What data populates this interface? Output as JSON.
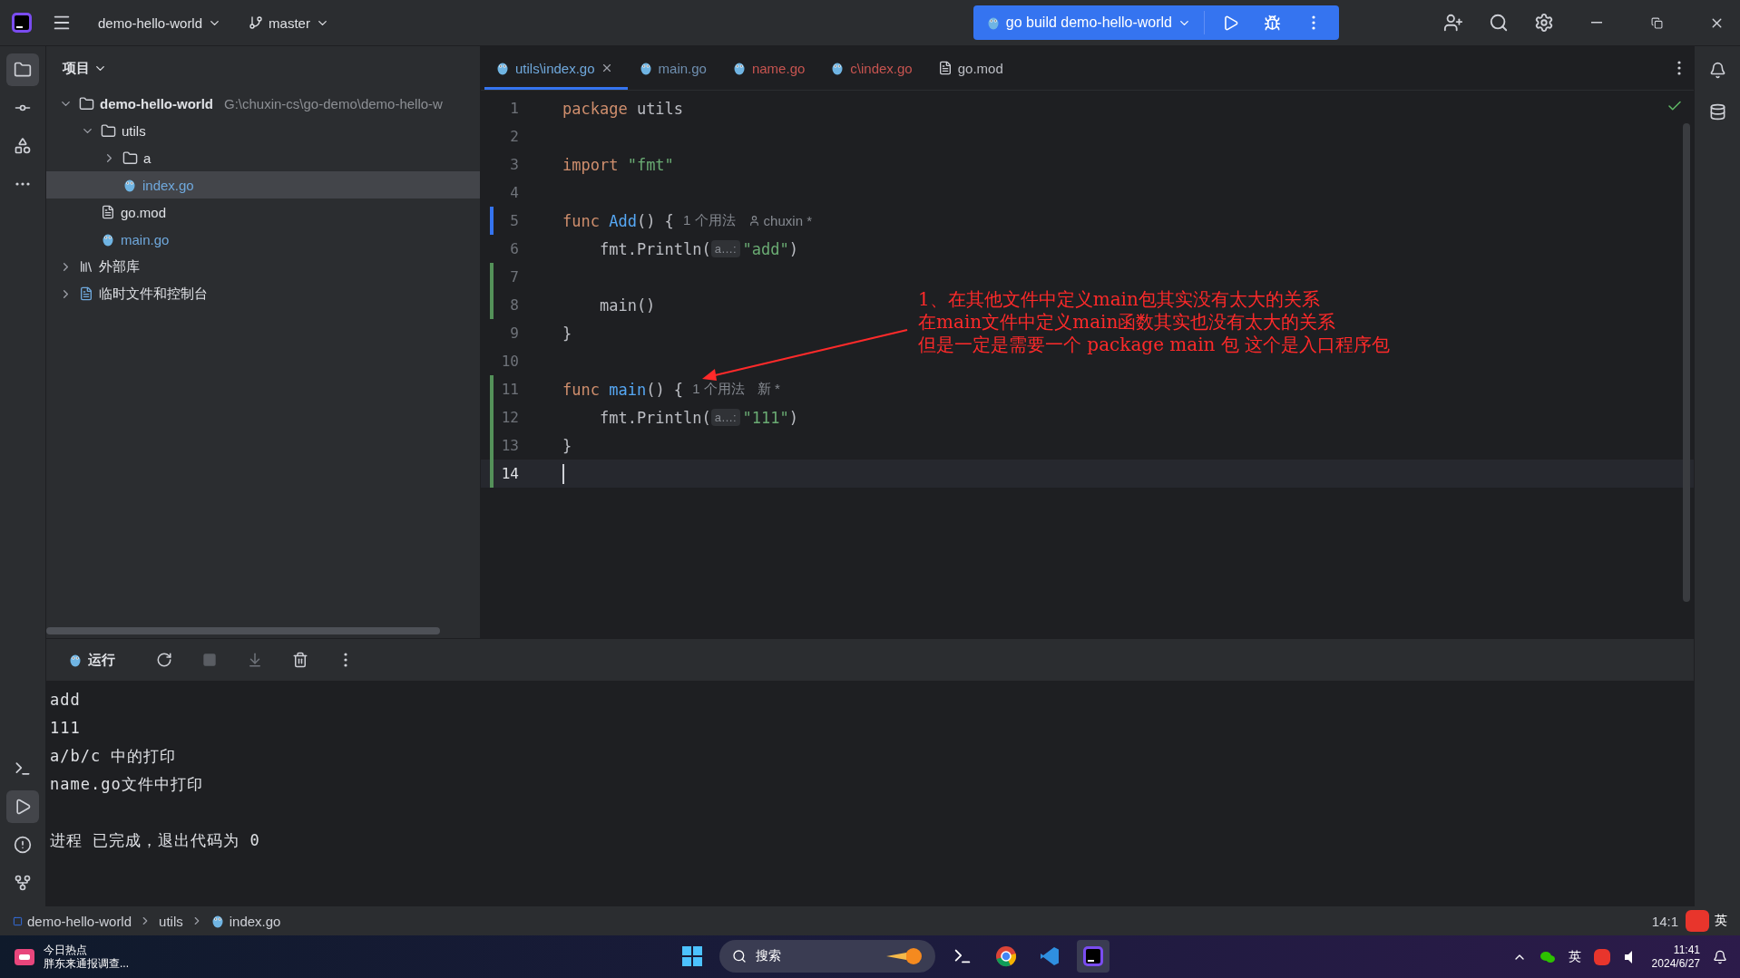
{
  "title_bar": {
    "project": "demo-hello-world",
    "branch": "master",
    "run_config": "go build demo-hello-world"
  },
  "project_panel": {
    "title": "项目",
    "tree": [
      {
        "label": "demo-hello-world",
        "path": "G:\\chuxin-cs\\go-demo\\demo-hello-w",
        "kind": "folder",
        "expanded": true,
        "selected": false,
        "children": [
          {
            "label": "utils",
            "kind": "folder",
            "expanded": true,
            "selected": false,
            "children": [
              {
                "label": "a",
                "kind": "folder",
                "expanded": false,
                "selected": false
              },
              {
                "label": "index.go",
                "kind": "gofile",
                "selected": true
              }
            ]
          },
          {
            "label": "go.mod",
            "kind": "modfile",
            "selected": false
          },
          {
            "label": "main.go",
            "kind": "gofile",
            "selected": false
          }
        ]
      },
      {
        "label": "外部库",
        "kind": "library",
        "expanded": false,
        "selected": false
      },
      {
        "label": "临时文件和控制台",
        "kind": "scratch",
        "expanded": false,
        "selected": false
      }
    ]
  },
  "editor": {
    "tabs": [
      {
        "label": "utils\\index.go",
        "kind": "gofile",
        "color": "#6fa8dc",
        "selected": true
      },
      {
        "label": "main.go",
        "kind": "gofile",
        "color": "#6f8fb0",
        "selected": false
      },
      {
        "label": "name.go",
        "kind": "gofile",
        "color": "#c75450",
        "selected": false
      },
      {
        "label": "c\\index.go",
        "kind": "gofile",
        "color": "#c75450",
        "selected": false
      },
      {
        "label": "go.mod",
        "kind": "modfile",
        "color": "#bcbec4",
        "selected": false
      }
    ],
    "lines": [
      {
        "number": "1",
        "modified": false,
        "added": false,
        "tokens": [
          {
            "kind": "kw",
            "text": "package "
          },
          {
            "kind": "plain",
            "text": "utils"
          }
        ]
      },
      {
        "number": "2",
        "modified": false,
        "added": false
      },
      {
        "number": "3",
        "modified": false,
        "added": false,
        "tokens": [
          {
            "kind": "kw",
            "text": "import "
          },
          {
            "kind": "str",
            "text": "\"fmt\""
          }
        ]
      },
      {
        "number": "4",
        "modified": false,
        "added": false
      },
      {
        "number": "5",
        "modified": true,
        "added": false,
        "tokens": [
          {
            "kind": "kw",
            "text": "func "
          },
          {
            "kind": "fn",
            "text": "Add"
          },
          {
            "kind": "plain",
            "text": "() { "
          },
          {
            "kind": "hint",
            "text": "1 个用法"
          },
          {
            "kind": "author",
            "text": "chuxin *"
          }
        ]
      },
      {
        "number": "6",
        "modified": false,
        "added": false,
        "tokens": [
          {
            "kind": "plain",
            "text": "    fmt.Println("
          },
          {
            "kind": "inlay",
            "text": "a…:"
          },
          {
            "kind": "str",
            "text": "\"add\""
          },
          {
            "kind": "plain",
            "text": ")"
          }
        ]
      },
      {
        "number": "7",
        "modified": false,
        "added": true
      },
      {
        "number": "8",
        "modified": false,
        "added": true,
        "tokens": [
          {
            "kind": "plain",
            "text": "    main()"
          }
        ]
      },
      {
        "number": "9",
        "modified": false,
        "added": false,
        "tokens": [
          {
            "kind": "plain",
            "text": "}"
          }
        ]
      },
      {
        "number": "10",
        "modified": false,
        "added": false
      },
      {
        "number": "11",
        "modified": false,
        "added": true,
        "tokens": [
          {
            "kind": "kw",
            "text": "func "
          },
          {
            "kind": "fn",
            "text": "main"
          },
          {
            "kind": "plain",
            "text": "() { "
          },
          {
            "kind": "hint",
            "text": "1 个用法"
          },
          {
            "kind": "hint",
            "text": "新 *"
          }
        ]
      },
      {
        "number": "12",
        "modified": false,
        "added": true,
        "tokens": [
          {
            "kind": "plain",
            "text": "    fmt.Println("
          },
          {
            "kind": "inlay",
            "text": "a…:"
          },
          {
            "kind": "str",
            "text": "\"111\""
          },
          {
            "kind": "plain",
            "text": ")"
          }
        ]
      },
      {
        "number": "13",
        "modified": false,
        "added": true,
        "tokens": [
          {
            "kind": "plain",
            "text": "}"
          }
        ]
      },
      {
        "number": "14",
        "modified": false,
        "added": true,
        "current": true
      }
    ],
    "annotation": [
      "1、在其他文件中定义main包其实没有太大的关系",
      "在main文件中定义main函数其实也没有太大的关系",
      "但是一定是需要一个 package main 包 这个是入口程序包"
    ]
  },
  "run_panel": {
    "tab": "运行",
    "output": [
      "add",
      "111",
      "a/b/c 中的打印",
      "name.go文件中打印"
    ],
    "exit_message": "进程 已完成，退出代码为 0"
  },
  "status_bar": {
    "breadcrumbs": [
      {
        "label": "demo-hello-world",
        "kind": "module"
      },
      {
        "label": "utils",
        "kind": "folder"
      },
      {
        "label": "index.go",
        "kind": "gofile"
      }
    ],
    "position": "14:1",
    "ime": "英"
  },
  "taskbar": {
    "news_title": "今日热点",
    "news_text": "胖东来通报调查...",
    "search": "搜索",
    "language": "英",
    "time": "11:41",
    "date": "2024/6/27"
  }
}
